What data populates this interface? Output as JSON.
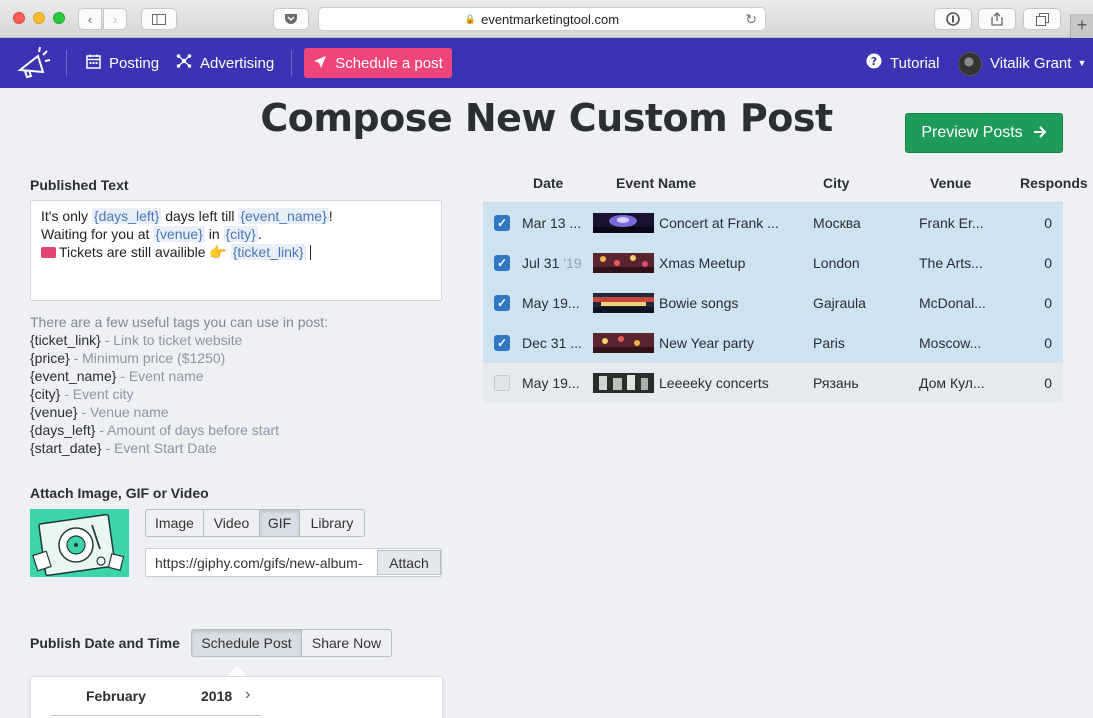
{
  "browser": {
    "url": "eventmarketingtool.com"
  },
  "nav": {
    "posting": "Posting",
    "advertising": "Advertising",
    "schedule": "Schedule a post",
    "tutorial": "Tutorial",
    "user": "Vitalik Grant"
  },
  "page": {
    "title": "Compose New Custom Post",
    "preview": "Preview Posts"
  },
  "published": {
    "label": "Published Text",
    "line1": {
      "a": "It's only ",
      "t1": "{days_left}",
      "b": " days left till ",
      "t2": "{event_name}",
      "c": "!"
    },
    "line2": {
      "a": "Waiting for you at ",
      "t1": "{venue}",
      "b": " in ",
      "t2": "{city}",
      "c": "."
    },
    "line3": {
      "a": "Tickets are still availible ",
      "emoji": "👉",
      "t1": "{ticket_link}"
    }
  },
  "tags": {
    "intro": "There are a few useful tags you can use in post:",
    "items": [
      {
        "tag": "{ticket_link}",
        "desc": " - Link to ticket website"
      },
      {
        "tag": "{price}",
        "desc": " - Minimum price ($1250)"
      },
      {
        "tag": "{event_name}",
        "desc": " - Event name"
      },
      {
        "tag": "{city}",
        "desc": " - Event city"
      },
      {
        "tag": "{venue}",
        "desc": " - Venue name"
      },
      {
        "tag": "{days_left}",
        "desc": " - Amount of days before start"
      },
      {
        "tag": "{start_date}",
        "desc": " - Event Start Date"
      }
    ]
  },
  "attach": {
    "label": "Attach Image, GIF or Video",
    "tabs": [
      "Image",
      "Video",
      "GIF",
      "Library"
    ],
    "active_tab": "GIF",
    "url_value": "https://giphy.com/gifs/new-album-",
    "attach_button": "Attach"
  },
  "publish": {
    "label": "Publish Date and Time",
    "options": [
      "Schedule Post",
      "Share Now"
    ],
    "active": "Schedule Post"
  },
  "calendar": {
    "month": "February",
    "year": "2018"
  },
  "table": {
    "headers": {
      "date": "Date",
      "event": "Event Name",
      "city": "City",
      "venue": "Venue",
      "responds": "Responds"
    },
    "rows": [
      {
        "checked": true,
        "date": "Mar 13 ...",
        "year": "",
        "event": "Concert at Frank ...",
        "city": "Москва",
        "venue": "Frank Er...",
        "responds": "0"
      },
      {
        "checked": true,
        "date": "Jul 31",
        "year": "'19",
        "event": "Xmas Meetup",
        "city": "London",
        "venue": "The Arts...",
        "responds": "0"
      },
      {
        "checked": true,
        "date": "May 19...",
        "year": "",
        "event": "Bowie songs",
        "city": "Gajraula",
        "venue": "McDonal...",
        "responds": "0"
      },
      {
        "checked": true,
        "date": "Dec 31 ...",
        "year": "",
        "event": "New Year party",
        "city": "Paris",
        "venue": "Moscow...",
        "responds": "0"
      },
      {
        "checked": false,
        "date": "May 19...",
        "year": "",
        "event": "Leeeeky concerts",
        "city": "Рязань",
        "venue": "Дом Кул...",
        "responds": "0"
      }
    ]
  },
  "colors": {
    "navbar": "#3a34b5",
    "schedule_button": "#f0457a",
    "preview_button": "#1e9b5a",
    "selected_row": "#cfe2f0",
    "checkbox": "#2f78c4"
  }
}
